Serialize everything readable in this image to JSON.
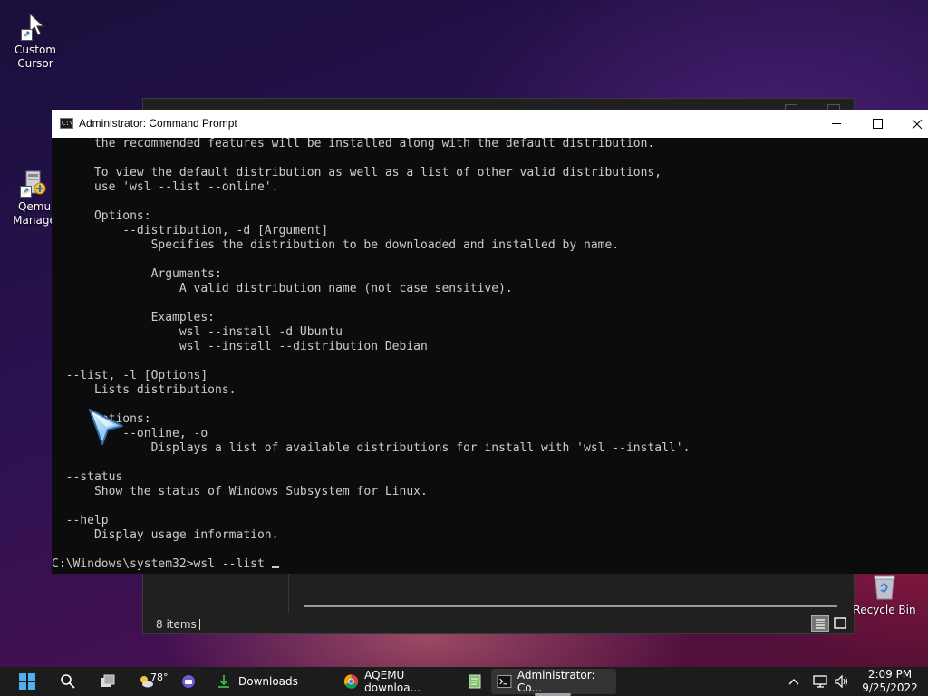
{
  "desktop": {
    "icons": [
      {
        "label_line1": "Custom",
        "label_line2": "Cursor",
        "icon": "custom-cursor-shortcut-icon"
      },
      {
        "label_line1": "Qemu",
        "label_line2": "Manage",
        "icon": "qemu-manager-shortcut-icon"
      }
    ],
    "recycle_bin": {
      "label": "Recycle Bin",
      "icon": "recycle-bin-icon"
    }
  },
  "explorer_window": {
    "status_items": "8 items"
  },
  "cmd_window": {
    "title": "Administrator: Command Prompt",
    "lines": [
      "      the recommended features will be installed along with the default distribution.",
      "",
      "      To view the default distribution as well as a list of other valid distributions,",
      "      use 'wsl --list --online'.",
      "",
      "      Options:",
      "          --distribution, -d [Argument]",
      "              Specifies the distribution to be downloaded and installed by name.",
      "",
      "              Arguments:",
      "                  A valid distribution name (not case sensitive).",
      "",
      "              Examples:",
      "                  wsl --install -d Ubuntu",
      "                  wsl --install --distribution Debian",
      "",
      "  --list, -l [Options]",
      "      Lists distributions.",
      "",
      "      Options:",
      "          --online, -o",
      "              Displays a list of available distributions for install with 'wsl --install'.",
      "",
      "  --status",
      "      Show the status of Windows Subsystem for Linux.",
      "",
      "  --help",
      "      Display usage information.",
      "",
      "C:\\Windows\\system32>wsl --list"
    ]
  },
  "taskbar": {
    "weather_temp": "78°",
    "downloads_label": "Downloads",
    "chrome_label": "AQEMU downloa...",
    "cmd_label": "Administrator: Co...",
    "time": "2:09 PM",
    "date": "9/25/2022"
  },
  "colors": {
    "console_bg": "#0c0c0c",
    "console_text": "#cccccc",
    "taskbar_bg": "#1c1c1c"
  }
}
